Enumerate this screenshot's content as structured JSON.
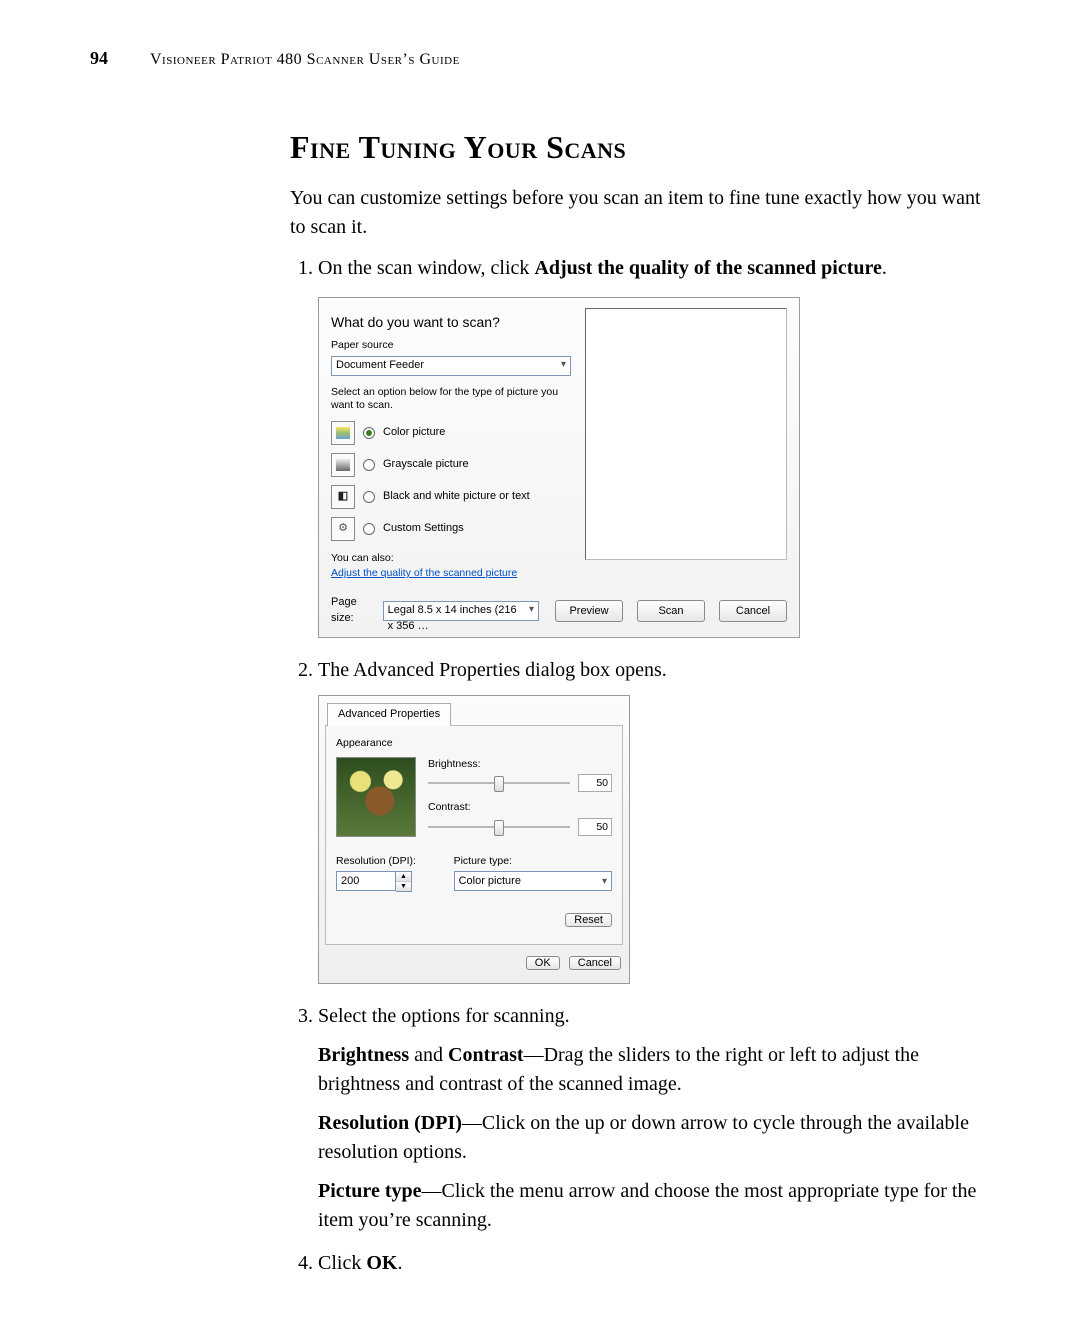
{
  "page": {
    "number": "94",
    "running_head": "Visioneer Patriot 480 Scanner User’s Guide"
  },
  "section": {
    "title": "Fine Tuning Your Scans",
    "intro": "You can customize settings before you scan an item to fine tune exactly how you want to scan it."
  },
  "steps": {
    "s1_pre": "On the scan window, click ",
    "s1_bold": "Adjust the quality of the scanned picture",
    "s1_post": ".",
    "s2": "The Advanced Properties dialog box opens.",
    "s3": "Select the options for scanning.",
    "s3_b1_bold1": "Brightness",
    "s3_b1_mid": " and ",
    "s3_b1_bold2": "Contrast",
    "s3_b1_rest": "—Drag the sliders to the right or left to adjust the brightness and contrast of the scanned image.",
    "s3_b2_bold": "Resolution (DPI)",
    "s3_b2_rest": "—Click on the up or down arrow to cycle through the available resolution options.",
    "s3_b3_bold": "Picture type",
    "s3_b3_rest": "—Click the menu arrow and choose the most appropriate type for the item you’re scanning.",
    "s4_pre": "Click ",
    "s4_bold": "OK",
    "s4_post": "."
  },
  "dialog1": {
    "title": "What do you want to scan?",
    "paper_source_label": "Paper source",
    "paper_source_value": "Document Feeder",
    "hint": "Select an option below for the type of picture you want to scan.",
    "opt_color": "Color picture",
    "opt_gray": "Grayscale picture",
    "opt_bw": "Black and white picture or text",
    "opt_custom": "Custom Settings",
    "also_label": "You can also:",
    "adjust_link": "Adjust the quality of the scanned picture",
    "page_size_label": "Page size:",
    "page_size_value": "Legal 8.5 x 14 inches (216 x 356 …",
    "btn_preview": "Preview",
    "btn_scan": "Scan",
    "btn_cancel": "Cancel"
  },
  "dialog2": {
    "tab": "Advanced Properties",
    "group": "Appearance",
    "brightness_label": "Brightness:",
    "brightness_value": "50",
    "contrast_label": "Contrast:",
    "contrast_value": "50",
    "resolution_label": "Resolution (DPI):",
    "resolution_value": "200",
    "picture_type_label": "Picture type:",
    "picture_type_value": "Color picture",
    "btn_reset": "Reset",
    "btn_ok": "OK",
    "btn_cancel": "Cancel"
  }
}
